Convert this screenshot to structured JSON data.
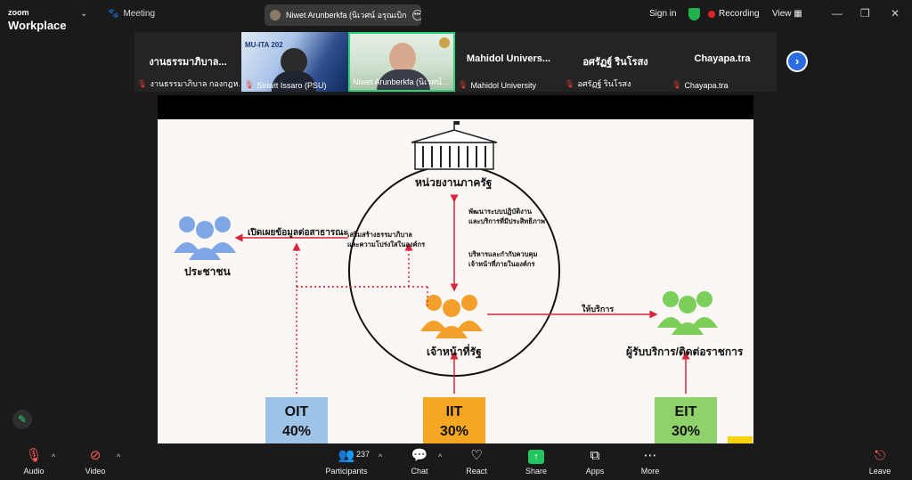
{
  "app": {
    "brand_small": "zoom",
    "brand_big": "Workplace",
    "meeting_label": "Meeting"
  },
  "active_speaker": {
    "name": "Niwet Arunberkfa (นิเวศน์ อรุณเบิก"
  },
  "topbar": {
    "signin": "Sign in",
    "recording": "Recording",
    "view": "View"
  },
  "gallery": [
    {
      "big": "งานธรรมาภิบาล...",
      "name": "งานธรรมาภิบาล กองกฎห..."
    },
    {
      "big": "",
      "name": "Siriwit Issaro (PSU)",
      "overlay": "MU-ITA 202"
    },
    {
      "big": "",
      "name": "Niwet Arunberkfa (นิเวศน์..."
    },
    {
      "big": "Mahidol Univers...",
      "name": "Mahidol University"
    },
    {
      "big": "อศรัฏฐ์ รินโรสง",
      "name": "อศรัฏฐ์ รินโรสง"
    },
    {
      "big": "Chayapa.tra",
      "name": "Chayapa.tra"
    }
  ],
  "slide": {
    "agency": "หน่วยงานภาครัฐ",
    "public": "ประชาชน",
    "disclose": "เปิดเผยข้อมูลต่อสาธารณะ",
    "governance_1": "เสริมสร้างธรรมาภิบาล",
    "governance_2": "และความโปร่งใสในองค์กร",
    "develop_1": "พัฒนาระบบปฏิบัติงาน",
    "develop_2": "และบริการที่มีประสิทธิภาพ",
    "manage_1": "บริหารและกำกับควบคุม",
    "manage_2": "เจ้าหน้าที่ภายในองค์กร",
    "staff": "เจ้าหน้าที่รัฐ",
    "service": "ให้บริการ",
    "recipients": "ผู้รับบริการ/ติดต่อราชการ",
    "boxes": [
      {
        "code": "OIT",
        "pct": "40%",
        "color": "#9dc3e6"
      },
      {
        "code": "IIT",
        "pct": "30%",
        "color": "#f5a623"
      },
      {
        "code": "EIT",
        "pct": "30%",
        "color": "#8fd16a"
      }
    ],
    "colors": {
      "public": "#7fa7e8",
      "staff": "#f2a02b",
      "recipients": "#7ccf5a",
      "arrow": "#d9263a"
    }
  },
  "toolbar": {
    "audio": "Audio",
    "video": "Video",
    "participants": "Participants",
    "participants_count": "237",
    "chat": "Chat",
    "react": "React",
    "share": "Share",
    "apps": "Apps",
    "more": "More",
    "leave": "Leave"
  }
}
